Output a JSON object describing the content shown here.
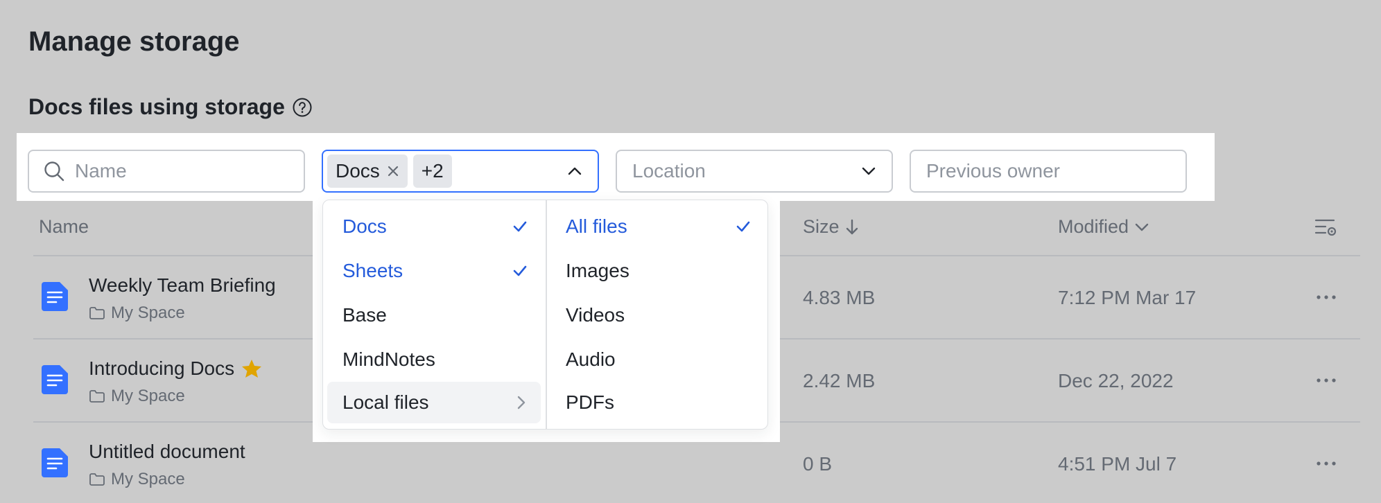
{
  "page": {
    "title": "Manage storage",
    "section_title": "Docs files using storage"
  },
  "filters": {
    "name_placeholder": "Name",
    "type_tag": "Docs",
    "type_more": "+2",
    "location_placeholder": "Location",
    "owner_placeholder": "Previous owner"
  },
  "table": {
    "columns": {
      "name": "Name",
      "size": "Size",
      "modified": "Modified"
    },
    "rows": [
      {
        "name": "Weekly Team Briefing",
        "location": "My Space",
        "size": "4.83 MB",
        "modified": "7:12 PM Mar 17",
        "starred": false
      },
      {
        "name": "Introducing Docs",
        "location": "My Space",
        "size": "2.42 MB",
        "modified": "Dec 22, 2022",
        "starred": true
      },
      {
        "name": "Untitled document",
        "location": "My Space",
        "size": "0 B",
        "modified": "4:51 PM Jul 7",
        "starred": false
      }
    ]
  },
  "dropdown": {
    "types": [
      {
        "label": "Docs",
        "selected": true
      },
      {
        "label": "Sheets",
        "selected": true
      },
      {
        "label": "Base",
        "selected": false
      },
      {
        "label": "MindNotes",
        "selected": false
      },
      {
        "label": "Local files",
        "selected": false
      }
    ],
    "subtypes": [
      {
        "label": "All files",
        "selected": true
      },
      {
        "label": "Images",
        "selected": false
      },
      {
        "label": "Videos",
        "selected": false
      },
      {
        "label": "Audio",
        "selected": false
      },
      {
        "label": "PDFs",
        "selected": false
      }
    ]
  },
  "colors": {
    "accent": "#3370ff",
    "selected_text": "#245bdb",
    "doc_icon": "#3370ff",
    "star": "#e0a400"
  }
}
